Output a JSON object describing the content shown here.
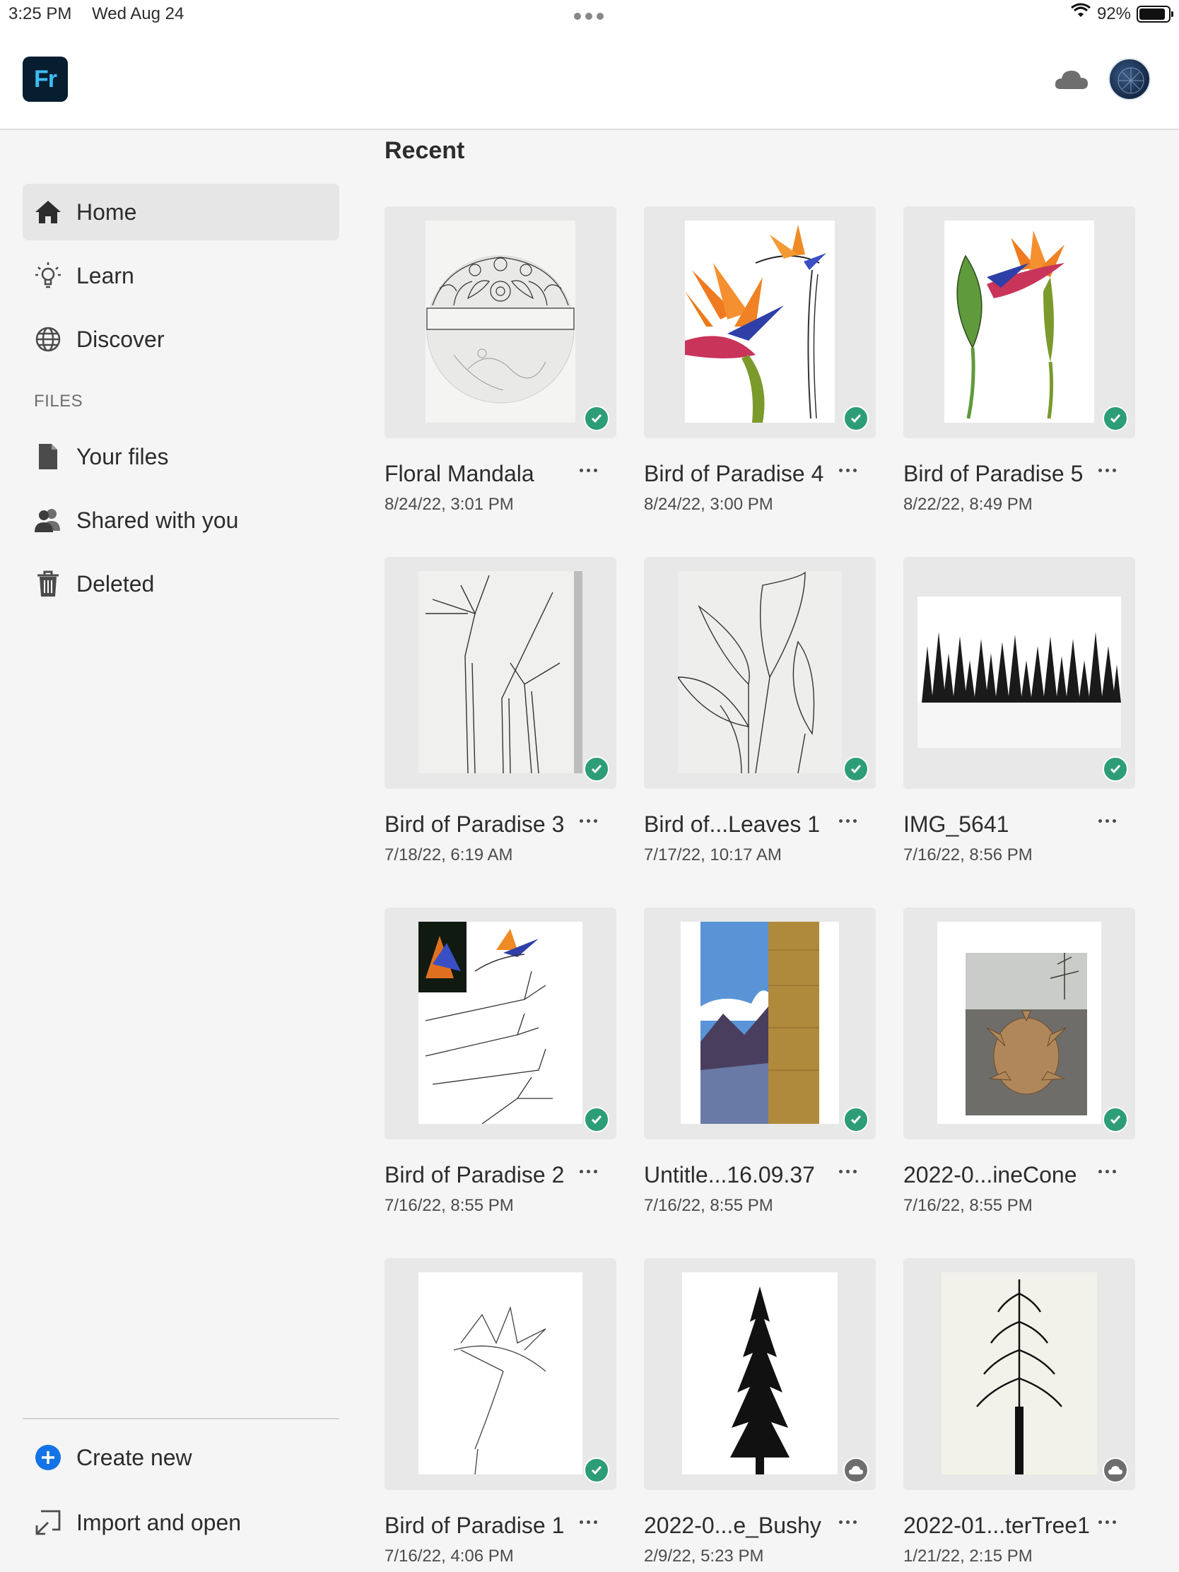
{
  "status_bar": {
    "time": "3:25 PM",
    "date": "Wed Aug 24",
    "battery_pct": "92%",
    "battery_level": 0.92
  },
  "header": {
    "app_logo": "Fr",
    "cloud_icon": "cloud-icon",
    "avatar_icon": "user-avatar"
  },
  "sidebar": {
    "items": [
      {
        "label": "Home",
        "icon": "home-icon",
        "active": true
      },
      {
        "label": "Learn",
        "icon": "lightbulb-icon"
      },
      {
        "label": "Discover",
        "icon": "globe-icon"
      }
    ],
    "files_section_label": "FILES",
    "files_items": [
      {
        "label": "Your files",
        "icon": "file-icon"
      },
      {
        "label": "Shared with you",
        "icon": "shared-users-icon"
      },
      {
        "label": "Deleted",
        "icon": "trash-icon"
      }
    ],
    "actions": [
      {
        "label": "Create new",
        "icon": "plus-circle-icon"
      },
      {
        "label": "Import and open",
        "icon": "import-icon"
      }
    ]
  },
  "main": {
    "section_title": "Recent",
    "files": [
      {
        "name": "Floral Mandala",
        "date": "8/24/22, 3:01 PM",
        "status": "synced",
        "thumb": "mandala"
      },
      {
        "name": "Bird of Paradise 4",
        "date": "8/24/22, 3:00 PM",
        "status": "synced",
        "thumb": "bop-color"
      },
      {
        "name": "Bird of Paradise 5",
        "date": "8/22/22, 8:49 PM",
        "status": "synced",
        "thumb": "bop-color-leaf"
      },
      {
        "name": "Bird of Paradise 3",
        "date": "7/18/22, 6:19 AM",
        "status": "synced",
        "thumb": "bop-sketch"
      },
      {
        "name": "Bird of...Leaves 1",
        "date": "7/17/22, 10:17 AM",
        "status": "synced",
        "thumb": "leaves-sketch"
      },
      {
        "name": "IMG_5641",
        "date": "7/16/22, 8:56 PM",
        "status": "synced",
        "thumb": "tree-line"
      },
      {
        "name": "Bird of Paradise 2",
        "date": "7/16/22, 8:55 PM",
        "status": "synced",
        "thumb": "bop-reference"
      },
      {
        "name": "Untitle...16.09.37",
        "date": "7/16/22, 8:55 PM",
        "status": "synced",
        "thumb": "mountains"
      },
      {
        "name": "2022-0...ineCone",
        "date": "7/16/22, 8:55 PM",
        "status": "synced",
        "thumb": "pinecone"
      },
      {
        "name": "Bird of Paradise 1",
        "date": "7/16/22, 4:06 PM",
        "status": "synced",
        "thumb": "bop-outline"
      },
      {
        "name": "2022-0...e_Bushy",
        "date": "2/9/22, 5:23 PM",
        "status": "cloud",
        "thumb": "tree-bushy"
      },
      {
        "name": "2022-01...terTree1",
        "date": "1/21/22, 2:15 PM",
        "status": "cloud",
        "thumb": "tree-winter"
      }
    ]
  },
  "colors": {
    "synced_badge": "#2d9d78",
    "cloud_badge": "#6e6e6e",
    "accent_blue": "#1473e6",
    "logo_bg": "#061e2f",
    "logo_text": "#3dbcf6"
  }
}
